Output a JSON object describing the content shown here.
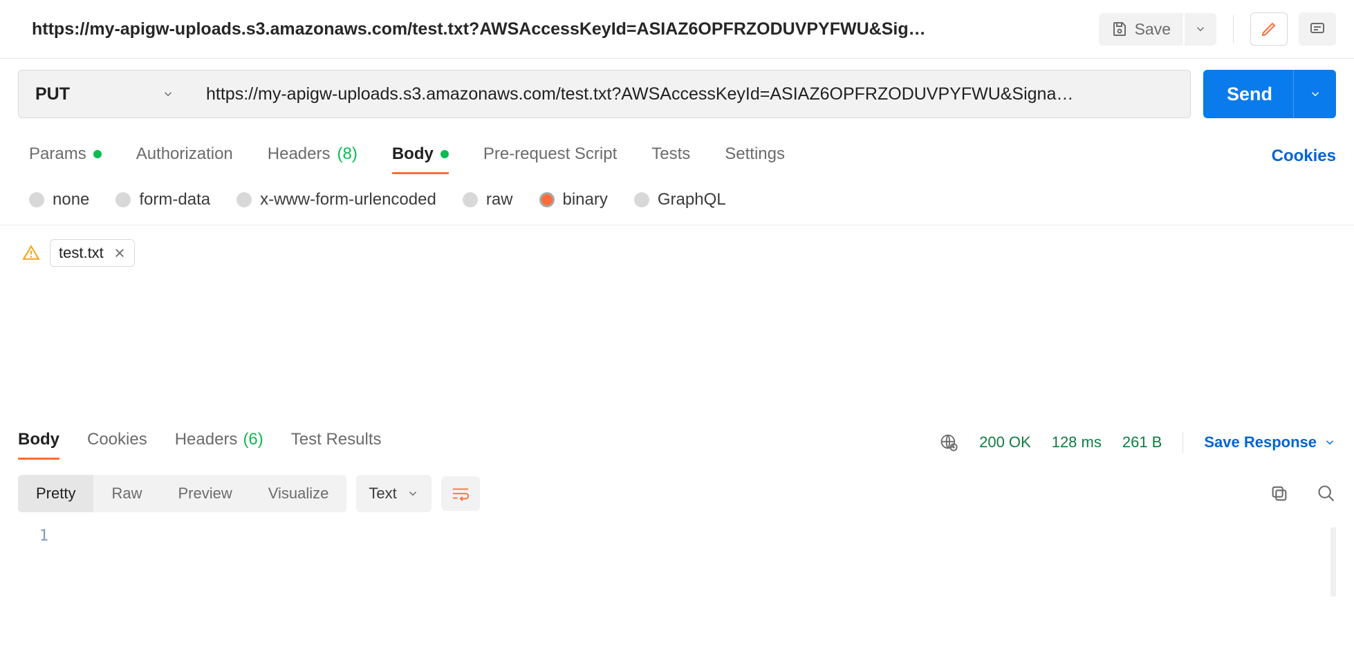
{
  "header": {
    "title": "https://my-apigw-uploads.s3.amazonaws.com/test.txt?AWSAccessKeyId=ASIAZ6OPFRZODUVPYFWU&Sig…",
    "save_label": "Save"
  },
  "request": {
    "method": "PUT",
    "url": "https://my-apigw-uploads.s3.amazonaws.com/test.txt?AWSAccessKeyId=ASIAZ6OPFRZODUVPYFWU&Signa…",
    "send_label": "Send"
  },
  "req_tabs": {
    "params": "Params",
    "authorization": "Authorization",
    "headers": "Headers",
    "headers_count": "(8)",
    "body": "Body",
    "prerequest": "Pre-request Script",
    "tests": "Tests",
    "settings": "Settings",
    "cookies": "Cookies"
  },
  "body_types": {
    "none": "none",
    "form_data": "form-data",
    "urlencoded": "x-www-form-urlencoded",
    "raw": "raw",
    "binary": "binary",
    "graphql": "GraphQL"
  },
  "file": {
    "name": "test.txt"
  },
  "resp_tabs": {
    "body": "Body",
    "cookies": "Cookies",
    "headers": "Headers",
    "headers_count": "(6)",
    "test_results": "Test Results"
  },
  "status": {
    "code": "200 OK",
    "time": "128 ms",
    "size": "261 B",
    "save_response": "Save Response"
  },
  "view_modes": {
    "pretty": "Pretty",
    "raw": "Raw",
    "preview": "Preview",
    "visualize": "Visualize",
    "type": "Text"
  },
  "response_body": {
    "line1_num": "1",
    "line1_text": ""
  }
}
